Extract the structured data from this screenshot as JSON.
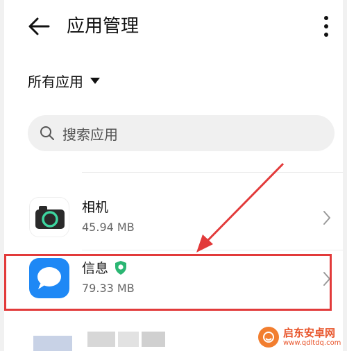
{
  "header": {
    "title": "应用管理",
    "back_icon": "arrow-left-icon",
    "menu_icon": "more-vertical-icon"
  },
  "filter": {
    "label": "所有应用"
  },
  "search": {
    "placeholder": "搜索应用"
  },
  "apps": [
    {
      "name": "相机",
      "size": "45.94 MB",
      "icon": "camera-icon",
      "icon_color": "#2a2a2a"
    },
    {
      "name": "信息",
      "size": "79.33 MB",
      "icon": "messages-icon",
      "icon_color": "#1e88f5",
      "badge": "shield-icon"
    }
  ],
  "annotation": {
    "color": "#e23a3a"
  },
  "watermark": {
    "name": "启东安卓网",
    "url": "www.qdltdq.com"
  }
}
